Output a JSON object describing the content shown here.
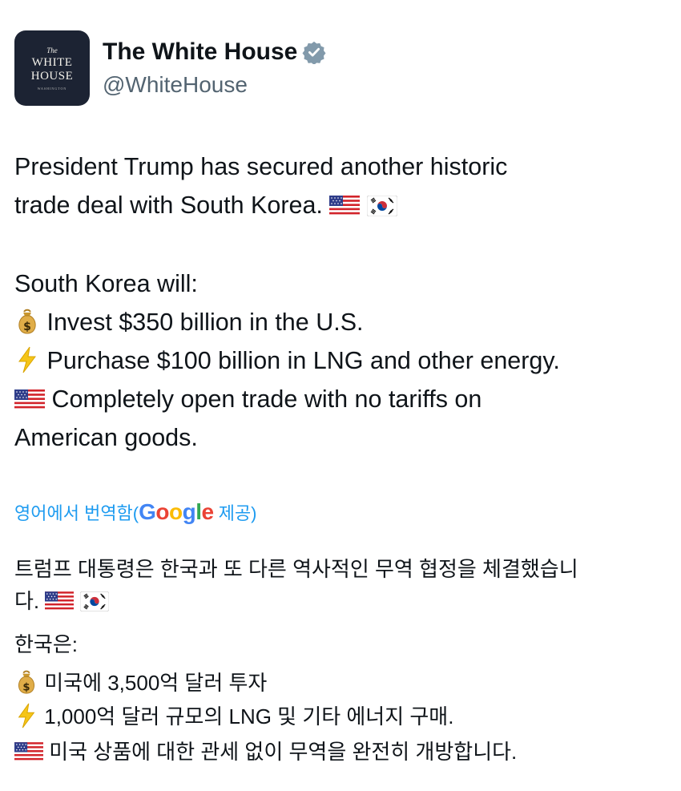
{
  "header": {
    "avatar": {
      "the": "The",
      "line1": "WHITE",
      "line2": "HOUSE",
      "sub": "WASHINGTON"
    },
    "name": "The White House",
    "handle": "@WhiteHouse"
  },
  "tweet": {
    "line1": "President Trump has secured another historic",
    "line2": "trade deal with South Korea.",
    "intro": "South Korea will:",
    "item1": "Invest $350 billion in the U.S.",
    "item2": "Purchase $100 billion in LNG and other energy.",
    "item3a": "Completely open trade with no tariffs on",
    "item3b": "American goods."
  },
  "translation": {
    "label_prefix": "영어에서 번역함(",
    "google": "Google",
    "label_suffix": " 제공)",
    "line1": "트럼프 대통령은 한국과 또 다른 역사적인 무역 협정을 체결했습니",
    "line2": "다.",
    "intro": "한국은:",
    "item1": "미국에 3,500억 달러 투자",
    "item2": "1,000억 달러 규모의 LNG 및 기타 에너지 구매.",
    "item3": "미국 상품에 대한 관세 없이 무역을 완전히 개방합니다."
  },
  "icons": [
    "verified-badge-icon",
    "money-bag-icon",
    "lightning-icon",
    "us-flag-icon",
    "south-korea-flag-icon"
  ],
  "colors": {
    "link": "#1d9bf0",
    "handle": "#536471",
    "verified": "#829aab",
    "avatar_bg": "#1c2333"
  }
}
